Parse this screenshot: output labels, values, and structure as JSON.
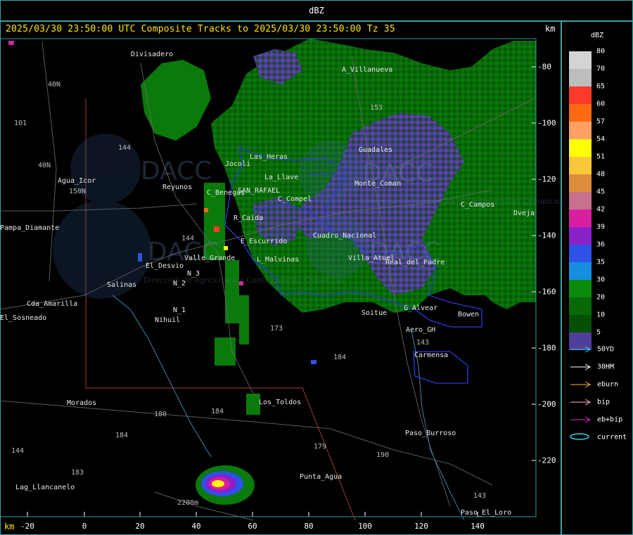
{
  "title": "dBZ",
  "subtitle": "2025/03/30 23:50:00 UTC Composite Tracks to 2025/03/30 23:50:00 Tz 35",
  "axis_unit": "km",
  "x_ticks": [
    "-20",
    "0",
    "20",
    "40",
    "60",
    "80",
    "100",
    "120",
    "140"
  ],
  "y_ticks": [
    "-80",
    "-100",
    "-120",
    "-140",
    "-160",
    "-180",
    "-200",
    "-220"
  ],
  "places": [
    "Divisadero",
    "A_Villanueva",
    "Jocoli",
    "Las_Heras",
    "Guadales",
    "Agua_Icor",
    "Reyunos",
    "C_Benegas",
    "SAN_RAFAEL",
    "C_Compel",
    "La_Llave",
    "R_Caida",
    "E_Escurrido",
    "Valle_Grande",
    "El_Desvio",
    "L_Malvinas",
    "Monte_Coman",
    "C_Campos",
    "Salinas",
    "Cda_Amarilla",
    "Nihuil",
    "N_1",
    "N_2",
    "N_3",
    "Soitue",
    "G_Alvear",
    "Aero_GH",
    "Bowen",
    "Carmensa",
    "Los_Toldos",
    "Morados",
    "Paso_Burroso",
    "Punta_Agua",
    "Lag_Llancanelo",
    "Paso_El_Loro",
    "Pampa_Diamante",
    "El_Sosneado",
    "Real_del_Padre",
    "Villa_Atuel",
    "Cuadro_Nacional",
    "Dveja"
  ],
  "routes": [
    "40N",
    "101",
    "153",
    "40N",
    "150N",
    "144",
    "173",
    "184",
    "180",
    "179",
    "143",
    "184",
    "190",
    "184",
    "183",
    "144",
    "144",
    "143",
    "2200m"
  ],
  "legend": {
    "title": "dBZ",
    "levels": [
      {
        "label": "80",
        "color": "#d4d4d4"
      },
      {
        "label": "70",
        "color": "#bdbdbd"
      },
      {
        "label": "65",
        "color": "#ff3a2a"
      },
      {
        "label": "60",
        "color": "#ff6a10"
      },
      {
        "label": "57",
        "color": "#ffa064"
      },
      {
        "label": "54",
        "color": "#ffff00"
      },
      {
        "label": "51",
        "color": "#f8c83a"
      },
      {
        "label": "48",
        "color": "#dd8c3c"
      },
      {
        "label": "45",
        "color": "#c87090"
      },
      {
        "label": "42",
        "color": "#d81fa0"
      },
      {
        "label": "39",
        "color": "#8a20c8"
      },
      {
        "label": "36",
        "color": "#2e52e6"
      },
      {
        "label": "35",
        "color": "#158ee0"
      },
      {
        "label": "30",
        "color": "#0a8a0a"
      },
      {
        "label": "20",
        "color": "#076a07"
      },
      {
        "label": "10",
        "color": "#034f03"
      },
      {
        "label": "5",
        "color": "#4f3f9a"
      }
    ],
    "tracks": [
      {
        "label": "50YD",
        "color": "#34d6ea"
      },
      {
        "label": "30HM",
        "color": "#ffffff"
      },
      {
        "label": "eburn",
        "color": "#f5b33a"
      },
      {
        "label": "bip",
        "color": "#ffb7c5"
      },
      {
        "label": "eb+bip",
        "color": "#d42bd4"
      },
      {
        "label": "current",
        "color": "#34d6ea"
      }
    ]
  },
  "watermark": [
    "DACC",
    "Direccion de Agricultura y Contingencias Climaticas"
  ]
}
